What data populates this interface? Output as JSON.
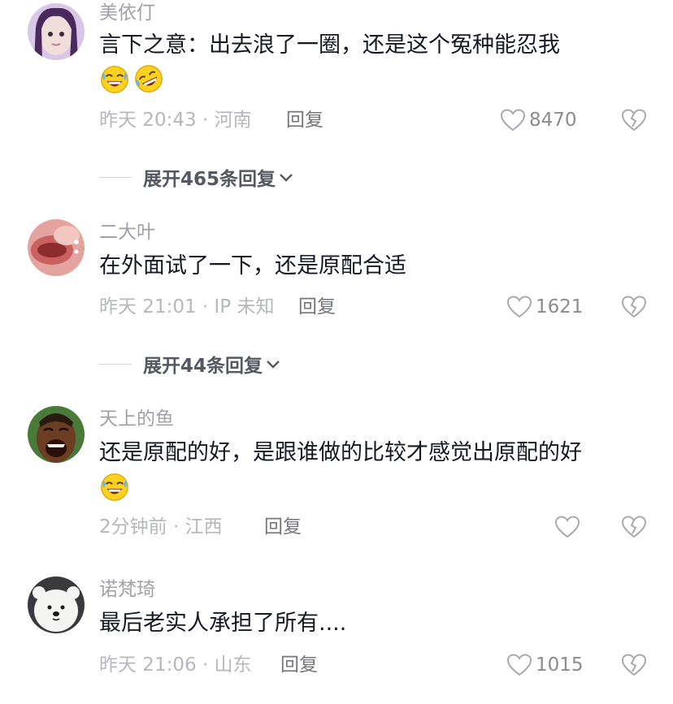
{
  "comments": [
    {
      "username": "美依仃",
      "text": "言下之意：出去浪了一圈，还是这个冤种能忍我",
      "emojis": [
        "grin-sweat-emoji",
        "rolling-laugh-emoji"
      ],
      "meta": "昨天 20:43 · 河南",
      "reply_label": "回复",
      "likes": "8470",
      "expand_label": "展开465条回复"
    },
    {
      "username": "二大叶",
      "text": "在外面试了一下，还是原配合适",
      "emojis": [],
      "meta": "昨天 21:01 · IP 未知",
      "reply_label": "回复",
      "likes": "1621",
      "expand_label": "展开44条回复"
    },
    {
      "username": "天上的鱼",
      "text": "还是原配的好，是跟谁做的比较才感觉出原配的好",
      "emojis": [
        "grin-sweat-emoji"
      ],
      "meta": "2分钟前 · 江西",
      "reply_label": "回复",
      "likes": "",
      "expand_label": ""
    },
    {
      "username": "诺梵琦",
      "text": "最后老实人承担了所有....",
      "emojis": [],
      "meta": "昨天 21:06 · 山东",
      "reply_label": "回复",
      "likes": "1015",
      "expand_label": ""
    }
  ],
  "colors": {
    "text": "#161823",
    "username": "#a0a2a8",
    "meta": "#b6b8bd",
    "reply": "#74767c",
    "expand": "#555860",
    "background": "#ffffff"
  },
  "icons": {
    "like": "heart-outline-icon",
    "dislike": "broken-heart-icon",
    "expand": "chevron-down-icon"
  }
}
